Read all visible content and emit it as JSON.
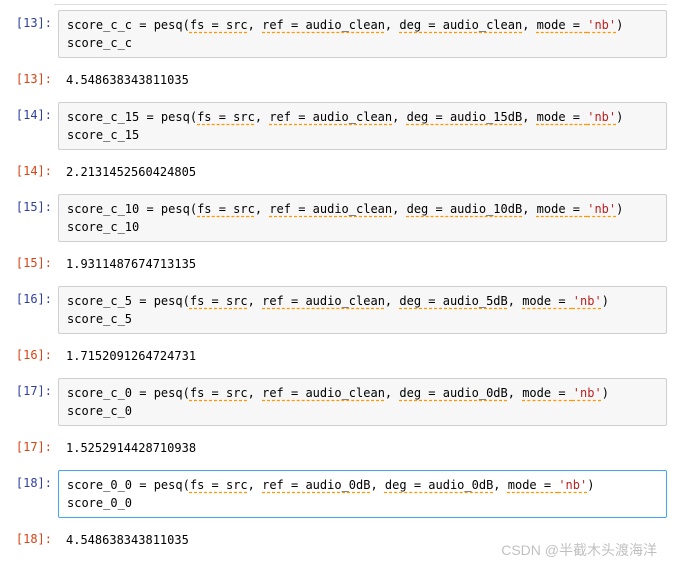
{
  "cells": [
    {
      "n": "13",
      "type": "in",
      "var": "score_c_c",
      "fn": "pesq",
      "args_styled": true,
      "fs": "src",
      "ref": "audio_clean",
      "deg": "audio_clean",
      "mode": "'nb'",
      "echo": "score_c_c"
    },
    {
      "n": "13",
      "type": "out",
      "text": "4.548638343811035"
    },
    {
      "n": "14",
      "type": "in",
      "var": "score_c_15",
      "fn": "pesq",
      "args_styled": true,
      "fs": "src",
      "ref": "audio_clean",
      "deg": "audio_15dB",
      "mode": "'nb'",
      "echo": "score_c_15"
    },
    {
      "n": "14",
      "type": "out",
      "text": "2.2131452560424805"
    },
    {
      "n": "15",
      "type": "in",
      "var": "score_c_10",
      "fn": "pesq",
      "args_styled": true,
      "fs": "src",
      "ref": "audio_clean",
      "deg": "audio_10dB",
      "mode": "'nb'",
      "echo": "score_c_10"
    },
    {
      "n": "15",
      "type": "out",
      "text": "1.9311487674713135"
    },
    {
      "n": "16",
      "type": "in",
      "var": "score_c_5",
      "fn": "pesq",
      "args_styled": true,
      "fs": "src",
      "ref": "audio_clean",
      "deg": "audio_5dB",
      "mode": "'nb'",
      "echo": "score_c_5"
    },
    {
      "n": "16",
      "type": "out",
      "text": "1.7152091264724731"
    },
    {
      "n": "17",
      "type": "in",
      "var": "score_c_0",
      "fn": "pesq",
      "args_styled": true,
      "fs": "src",
      "ref": "audio_clean",
      "deg": "audio_0dB",
      "mode": "'nb'",
      "echo": "score_c_0"
    },
    {
      "n": "17",
      "type": "out",
      "text": "1.5252914428710938"
    },
    {
      "n": "18",
      "type": "in",
      "var": "score_0_0",
      "selected": true,
      "fn": "pesq",
      "args_styled": true,
      "fs": "src",
      "ref": "audio_0dB",
      "deg": "audio_0dB",
      "mode": "'nb'",
      "echo": "score_0_0"
    },
    {
      "n": "18",
      "type": "out",
      "text": "4.548638343811035"
    }
  ],
  "watermark": "CSDN @半截木头渡海洋",
  "labels": {
    "in_open": "[",
    "in_close": "]:",
    "kw_fs": "fs",
    "kw_ref": "ref",
    "kw_deg": "deg",
    "kw_mode": "mode",
    "eq": " = ",
    "comma": ", "
  }
}
